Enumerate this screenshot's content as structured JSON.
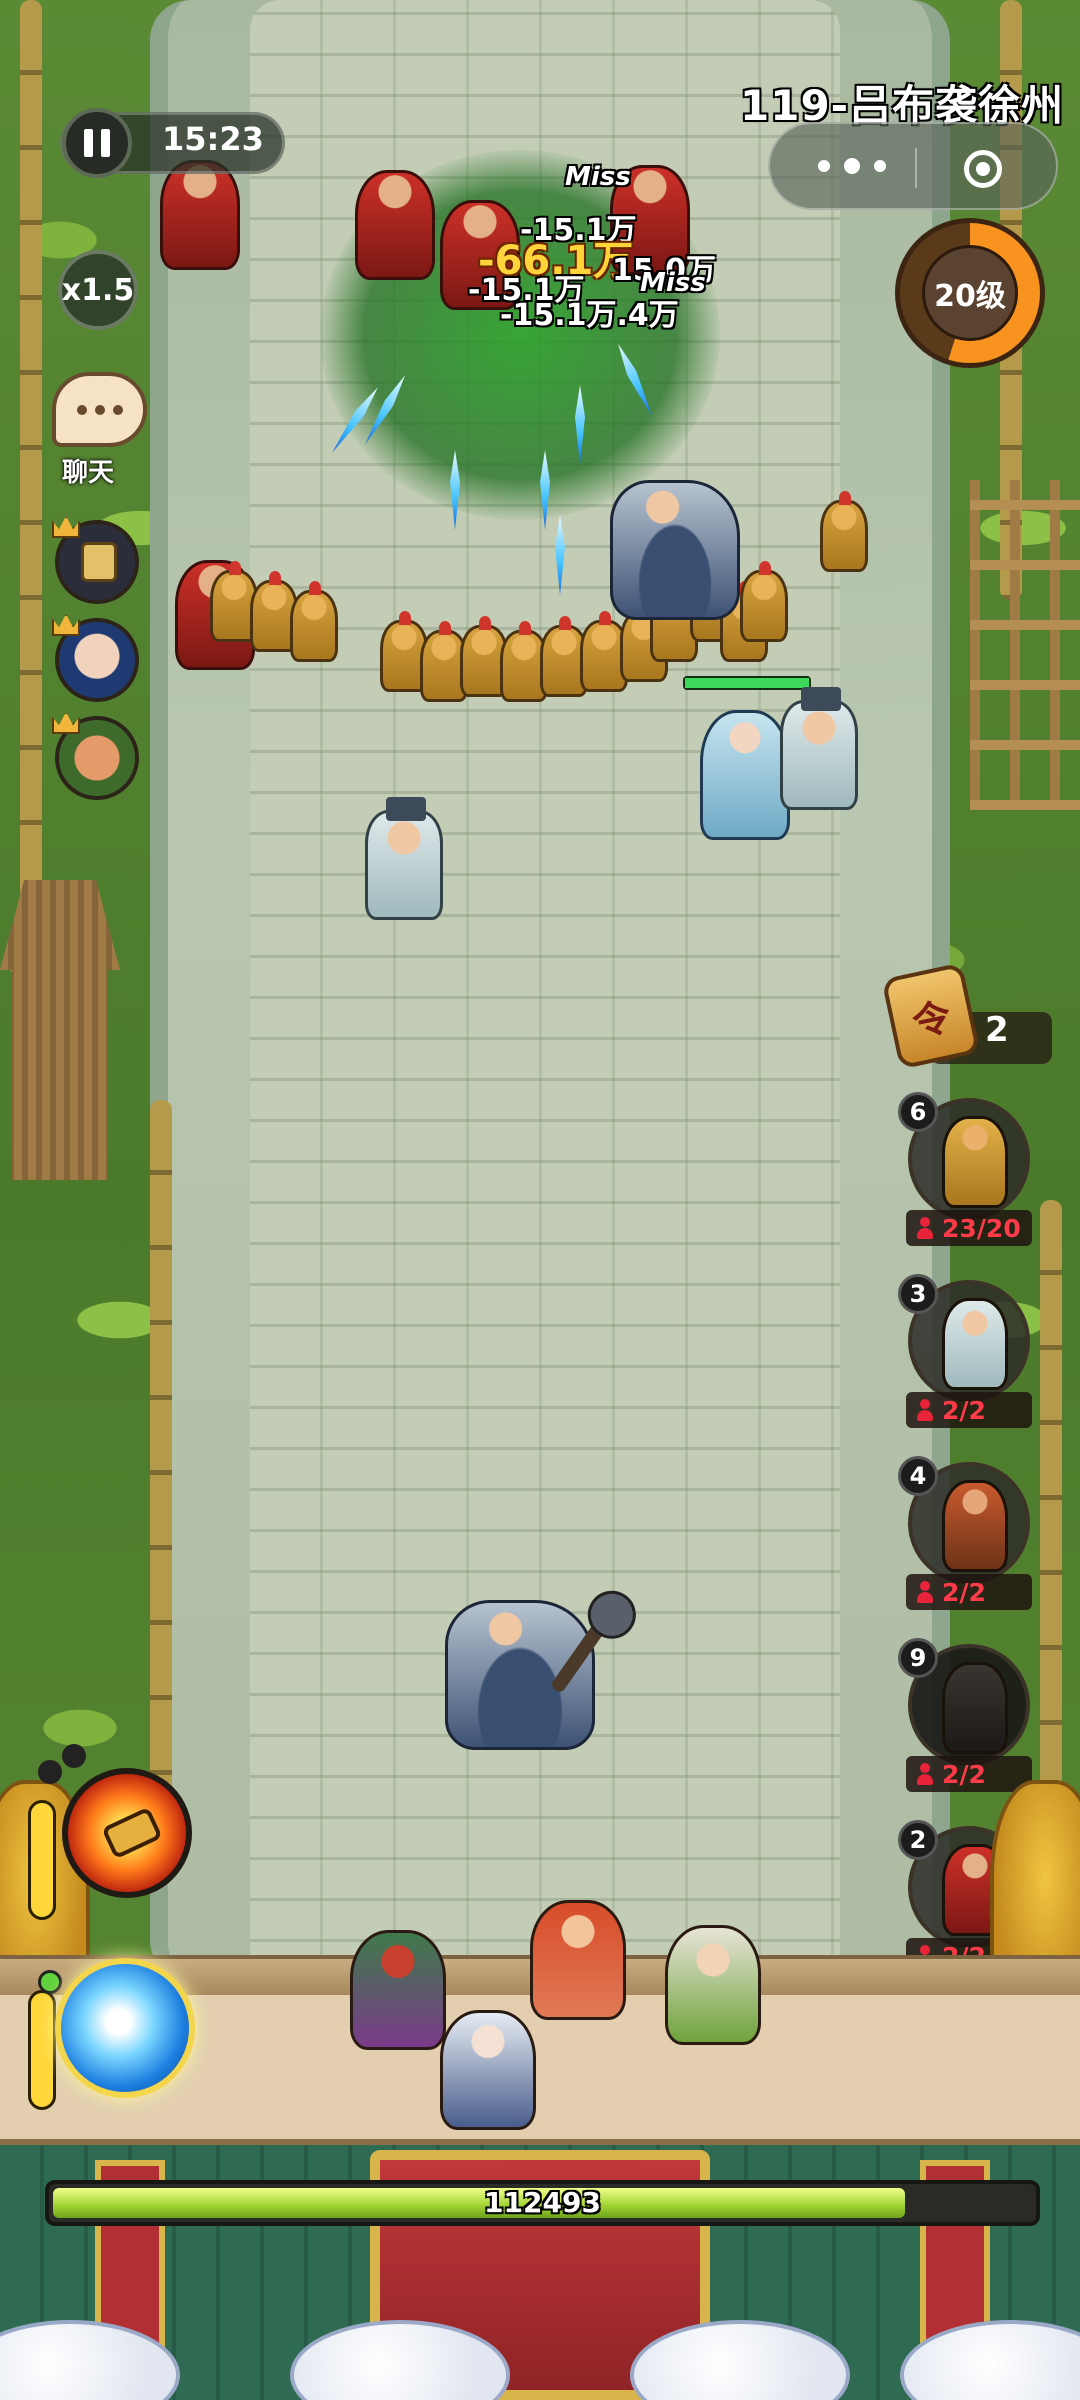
{
  "hud": {
    "timer": "15:23",
    "speed": "x1.5",
    "chat_label": "聊天",
    "stage_title": "119-吕布袭徐州",
    "player_level": "20级",
    "level_progress_percent": 55,
    "token_symbol": "令",
    "token_count": "2"
  },
  "damage_numbers": [
    {
      "text": "Miss",
      "style": "miss"
    },
    {
      "text": "-15.1万",
      "style": "white"
    },
    {
      "text": "-66.1万",
      "style": "yellow"
    },
    {
      "text": "-15.1万",
      "style": "white"
    },
    {
      "text": "15.0万",
      "style": "white"
    },
    {
      "text": "Miss",
      "style": "miss"
    },
    {
      "text": "-15.1万.4万",
      "style": "white"
    }
  ],
  "unit_cards": [
    {
      "cost": "6",
      "capacity": "23/20",
      "portrait": "gold-soldier-icon"
    },
    {
      "cost": "3",
      "capacity": "2/2",
      "portrait": "scholar-icon"
    },
    {
      "cost": "4",
      "capacity": "2/2",
      "portrait": "swordsman-icon"
    },
    {
      "cost": "9",
      "capacity": "2/2",
      "portrait": "dark-warrior-icon"
    },
    {
      "cost": "2",
      "capacity": "2/2",
      "portrait": "spearman-icon"
    }
  ],
  "skills": [
    {
      "name": "fire-hammer-skill",
      "icon": "hammer-icon"
    },
    {
      "name": "water-wave-skill",
      "icon": "wave-icon"
    }
  ],
  "base": {
    "hp_value": "112493",
    "hp_fraction": 0.87
  },
  "enemy_hp_fraction": 1.0,
  "colors": {
    "accent_orange": "#f7931e",
    "capacity_red": "#ff3b4a",
    "hp_green": "#3ed85a",
    "damage_yellow": "#ffd33a"
  }
}
